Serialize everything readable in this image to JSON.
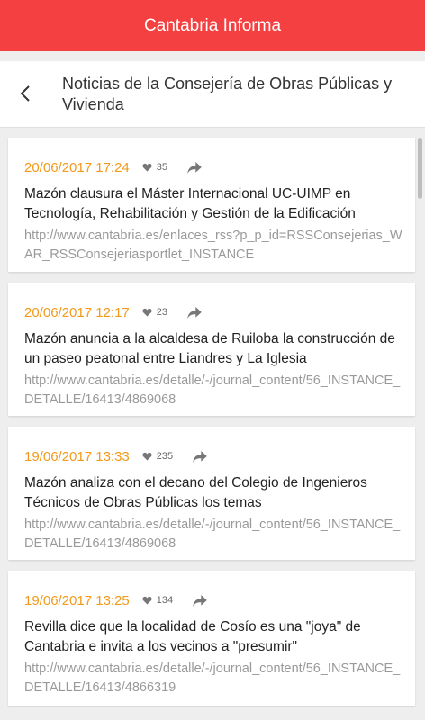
{
  "app": {
    "title": "Cantabria Informa"
  },
  "header": {
    "title": "Noticias de la Consejería de Obras Públicas y Vivienda"
  },
  "items": [
    {
      "date": "20/06/2017 17:24",
      "likes": "35",
      "title": "Mazón clausura el Máster Internacional UC-UIMP en Tecnología, Rehabilitación y Gestión de la Edificación",
      "url": "http://www.cantabria.es/enlaces_rss?p_p_id=RSSConsejerias_WAR_RSSConsejeriasportlet_INSTANCE"
    },
    {
      "date": "20/06/2017 12:17",
      "likes": "23",
      "title": "Mazón anuncia a la alcaldesa de Ruiloba la construcción de un paseo peatonal entre Liandres y La Iglesia",
      "url": "http://www.cantabria.es/detalle/-/journal_content/56_INSTANCE_DETALLE/16413/4869068"
    },
    {
      "date": "19/06/2017 13:33",
      "likes": "235",
      "title": "Mazón analiza con el decano del Colegio de Ingenieros Técnicos de Obras Públicas los temas",
      "url": "http://www.cantabria.es/detalle/-/journal_content/56_INSTANCE_DETALLE/16413/4869068"
    },
    {
      "date": "19/06/2017 13:25",
      "likes": "134",
      "title": "Revilla dice que la localidad de Cosío es una \"joya\" de Cantabria e invita a los vecinos a \"presumir\"",
      "url": "http://www.cantabria.es/detalle/-/journal_content/56_INSTANCE_DETALLE/16413/4866319"
    }
  ],
  "icons": {
    "back": "arrow-back-icon",
    "like": "heart-icon",
    "share": "share-icon"
  },
  "colors": {
    "appbar": "#f44040",
    "date": "#f29a1a"
  }
}
